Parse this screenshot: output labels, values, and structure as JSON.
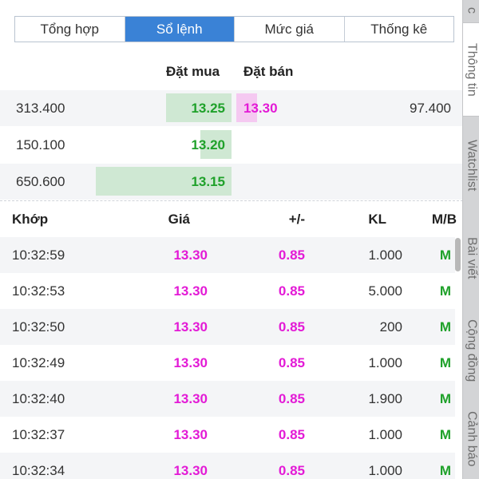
{
  "tabs": [
    "Tổng hợp",
    "Sổ lệnh",
    "Mức giá",
    "Thống kê"
  ],
  "active_tab": "Sổ lệnh",
  "side_tabs": [
    "c",
    "Thông tin",
    "Watchlist",
    "Bài viết",
    "Cộng đồng",
    "Cảnh báo"
  ],
  "orderbook": {
    "bid_header": "Đặt mua",
    "ask_header": "Đặt bán",
    "rows": [
      {
        "bid_vol": "313.400",
        "bid_price": "13.25",
        "ask_price": "13.30",
        "ask_vol": "97.400",
        "bid_fill": 0.48,
        "ask_fill": 0.15
      },
      {
        "bid_vol": "150.100",
        "bid_price": "13.20",
        "ask_price": "",
        "ask_vol": "",
        "bid_fill": 0.23,
        "ask_fill": 0
      },
      {
        "bid_vol": "650.600",
        "bid_price": "13.15",
        "ask_price": "",
        "ask_vol": "",
        "bid_fill": 1.0,
        "ask_fill": 0
      }
    ]
  },
  "trades": {
    "headers": {
      "time": "Khớp",
      "price": "Giá",
      "change": "+/-",
      "volume": "KL",
      "side": "M/B"
    },
    "rows": [
      {
        "time": "10:32:59",
        "price": "13.30",
        "change": "0.85",
        "volume": "1.000",
        "side": "M"
      },
      {
        "time": "10:32:53",
        "price": "13.30",
        "change": "0.85",
        "volume": "5.000",
        "side": "M"
      },
      {
        "time": "10:32:50",
        "price": "13.30",
        "change": "0.85",
        "volume": "200",
        "side": "M"
      },
      {
        "time": "10:32:49",
        "price": "13.30",
        "change": "0.85",
        "volume": "1.000",
        "side": "M"
      },
      {
        "time": "10:32:40",
        "price": "13.30",
        "change": "0.85",
        "volume": "1.900",
        "side": "M"
      },
      {
        "time": "10:32:37",
        "price": "13.30",
        "change": "0.85",
        "volume": "1.000",
        "side": "M"
      },
      {
        "time": "10:32:34",
        "price": "13.30",
        "change": "0.85",
        "volume": "1.000",
        "side": "M"
      }
    ]
  },
  "colors": {
    "accent": "#3a82d6",
    "buy": "#1fa12a",
    "up": "#e31ad6",
    "bid_bar": "#cfe8d3",
    "ask_bar": "#f5c9f1"
  }
}
